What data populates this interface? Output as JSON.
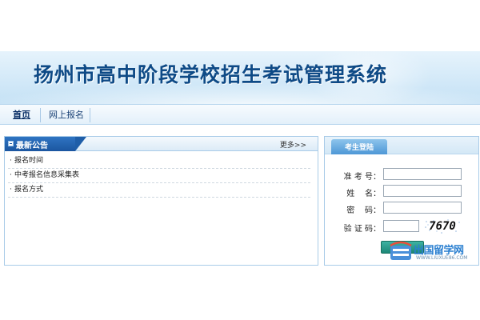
{
  "header": {
    "title": "扬州市高中阶段学校招生考试管理系统"
  },
  "nav": {
    "items": [
      {
        "label": "首页"
      },
      {
        "label": "网上报名"
      }
    ]
  },
  "news": {
    "title": "最新公告",
    "more_label": "更多>>",
    "items": [
      {
        "label": "报名时间"
      },
      {
        "label": "中考报名信息采集表"
      },
      {
        "label": "报名方式"
      }
    ]
  },
  "login": {
    "title": "考生登陆",
    "fields": {
      "exam_no_label": "准 考 号：",
      "name_label": "姓    名：",
      "password_label": "密    码：",
      "captcha_label": "验 证 码："
    },
    "captcha_value": "7670"
  },
  "watermark": {
    "text": "出国留学网",
    "url": "WWW.LIUXUE86.COM"
  },
  "colors": {
    "title": "#0e4a86",
    "accent_blue": "#1b56a0",
    "button_teal": "#1c8777"
  },
  "icons": {
    "bullet": "square-bullet-icon",
    "captcha": "captcha-image",
    "watermark_logo": "liuxue86-logo-icon"
  }
}
